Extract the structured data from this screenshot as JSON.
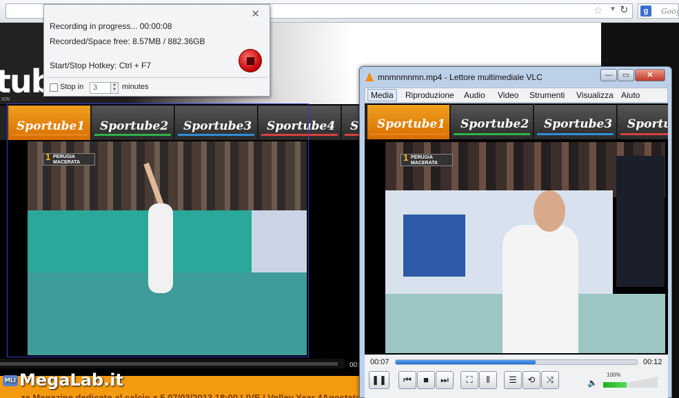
{
  "browser": {
    "search_engine_label": "Goog",
    "search_engine_icon": "google-icon"
  },
  "website": {
    "logo": "tube",
    "logo_sub": "ION",
    "tabs": [
      {
        "label": "Sportube1",
        "color": "#e8831a",
        "active": true
      },
      {
        "label": "Sportube2",
        "color": "#2fb34a",
        "active": false
      },
      {
        "label": "Sportube3",
        "color": "#2f8fd8",
        "active": false
      },
      {
        "label": "Sportube4",
        "color": "#d94040",
        "active": false
      },
      {
        "label": "S",
        "color": "#d94040",
        "active": false
      }
    ],
    "score_badge": {
      "number": "1",
      "line1": "PERUGIA",
      "line2": "MACERATA"
    },
    "time_label": "00:",
    "footer_ticker": "za  Magazine dedicato al calcio a 5         07/03/2013 18:00 LIVE | Volley Year   4Agostato  Ser",
    "watermark": "MegaLab.it",
    "watermark_badge": "MLI"
  },
  "recorder": {
    "status": "Recording in progress... 00:00:08",
    "recorded_space": "Recorded/Space free: 8.57MB / 882.36GB",
    "hotkey": "Start/Stop Hotkey:  Ctrl + F7",
    "stop_in_label": "Stop in",
    "stop_in_value": "3",
    "minutes_label": "minutes",
    "stop_in_checked": false,
    "close_glyph": "✕"
  },
  "vlc": {
    "title": "mnmnmnmn.mp4 - Lettore multimediale VLC",
    "menus": [
      "Media",
      "Riproduzione",
      "Audio",
      "Video",
      "Strumenti",
      "Visualizza",
      "Aiuto"
    ],
    "tabs": [
      {
        "label": "Sportube1",
        "color": "#e8831a",
        "active": true
      },
      {
        "label": "Sportube2",
        "color": "#2fb34a",
        "active": false
      },
      {
        "label": "Sportube3",
        "color": "#2f8fd8",
        "active": false
      },
      {
        "label": "Sportu",
        "color": "#d94040",
        "active": false
      }
    ],
    "score_badge": {
      "number": "1",
      "line1": "PERUGIA",
      "line2": "MACERATA"
    },
    "elapsed": "00:07",
    "total": "00:12",
    "progress": 0.58,
    "volume_label": "100%",
    "volume_level": 1.0,
    "controls": {
      "pause": "❚❚",
      "prev": "⏮",
      "stop": "■",
      "next": "⏭",
      "fullscreen": "⛶",
      "extended": "⫴",
      "playlist": "☰",
      "loop": "⟲",
      "shuffle": "⤨"
    }
  }
}
